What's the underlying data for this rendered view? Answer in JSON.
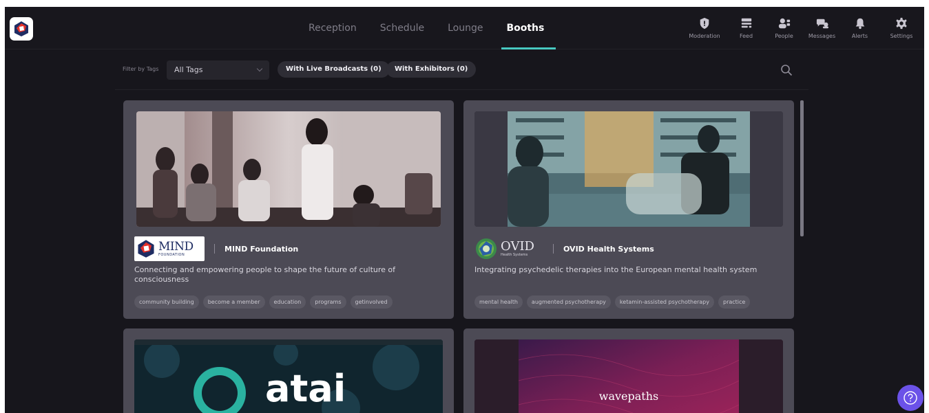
{
  "nav": {
    "tabs": [
      {
        "label": "Reception"
      },
      {
        "label": "Schedule"
      },
      {
        "label": "Lounge"
      },
      {
        "label": "Booths"
      }
    ],
    "active_tab": "Booths",
    "actions": [
      {
        "label": "Moderation",
        "icon": "shield-icon"
      },
      {
        "label": "Feed",
        "icon": "feed-icon"
      },
      {
        "label": "People",
        "icon": "people-icon"
      },
      {
        "label": "Messages",
        "icon": "messages-icon"
      },
      {
        "label": "Alerts",
        "icon": "bell-icon"
      },
      {
        "label": "Settings",
        "icon": "gear-icon"
      }
    ]
  },
  "filters": {
    "label": "Filter by Tags",
    "tag_select_value": "All Tags",
    "live_broadcasts_label": "With Live Broadcasts (0)",
    "exhibitors_label": "With Exhibitors (0)"
  },
  "booths": [
    {
      "logo_text": "MIND",
      "logo_subtext": "FOUNDATION",
      "name": "MIND Foundation",
      "description": "Connecting and empowering people to shape the future of culture of consciousness",
      "tags": [
        "community building",
        "become a member",
        "education",
        "programs",
        "getinvolved"
      ]
    },
    {
      "logo_text": "OVID",
      "logo_subtext": "Health Systems",
      "name": "OVID Health Systems",
      "description": "Integrating psychedelic therapies into the European mental health system",
      "tags": [
        "mental health",
        "augmented psychotherapy",
        "ketamin-assisted psychotherapy",
        "practice"
      ]
    },
    {
      "banner_text": "atai"
    },
    {
      "banner_text": "wavepaths"
    }
  ],
  "colors": {
    "background": "#17161c",
    "card": "#4c4a55",
    "accent": "#48c9c1",
    "help_button": "#6b52e8"
  }
}
